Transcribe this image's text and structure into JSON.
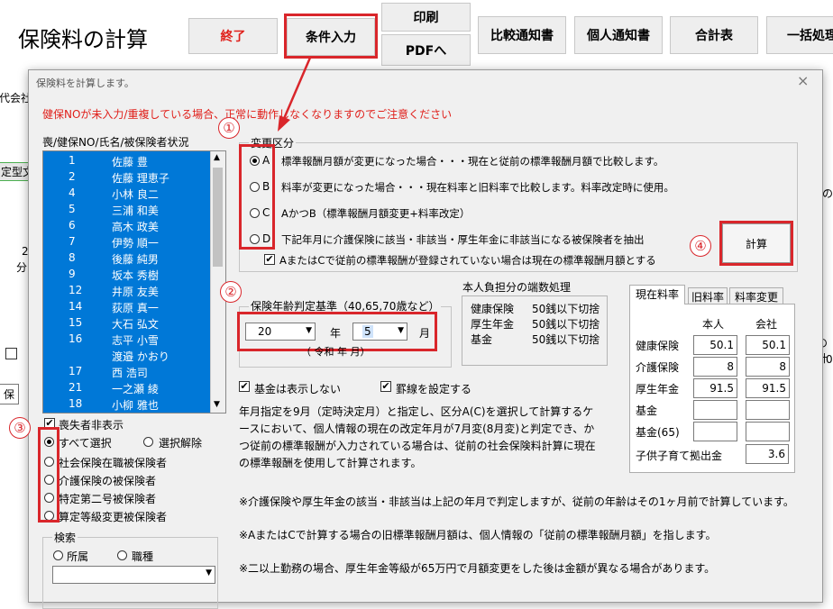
{
  "page_title": "保険料の計算",
  "toolbar": {
    "end": "終了",
    "condition_input": "条件入力",
    "print": "印刷",
    "to_pdf": "PDFへ",
    "compare_notice": "比較通知書",
    "personal_notice": "個人通知書",
    "total_table": "合計表",
    "batch": "一括処理"
  },
  "background": {
    "frag_company": "代会社",
    "frag_teiki": "定型文",
    "frag_bun": "分.",
    "frag_2": "2",
    "frag_ho": "保",
    "frag_no": "の",
    "frag_ke": "の計",
    "frag_0": "0"
  },
  "dialog": {
    "title": "保険料を計算します。",
    "close": "×",
    "warning": "健保NOが未入力/重複している場合、正常に動作しなくなりますのでご注意ください",
    "list_header": "喪/健保NO/氏名/被保険者状況",
    "employees": [
      {
        "no": "1",
        "name": "佐藤 豊"
      },
      {
        "no": "2",
        "name": "佐藤 理恵子"
      },
      {
        "no": "4",
        "name": "小林 良二"
      },
      {
        "no": "5",
        "name": "三浦 和美"
      },
      {
        "no": "6",
        "name": "高木 政美"
      },
      {
        "no": "7",
        "name": "伊勢 順一"
      },
      {
        "no": "8",
        "name": "後藤 純男"
      },
      {
        "no": "9",
        "name": "坂本 秀樹"
      },
      {
        "no": "12",
        "name": "井原 友美"
      },
      {
        "no": "14",
        "name": "荻原 真一"
      },
      {
        "no": "15",
        "name": "大石 弘文"
      },
      {
        "no": "16",
        "name": "志平 小雪"
      },
      {
        "no": "",
        "name": "渡邉 かおり"
      },
      {
        "no": "17",
        "name": "西 浩司"
      },
      {
        "no": "21",
        "name": "一之瀬 綾"
      },
      {
        "no": "18",
        "name": "小柳 雅也"
      }
    ],
    "hide_lost": "喪失者非表示",
    "select_all": "すべて選択",
    "deselect": "選択解除",
    "filters": [
      "社会保険在職被保険者",
      "介護保険の被保険者",
      "特定第二号被保険者",
      "算定等級変更被保険者"
    ],
    "search_legend": "検索",
    "search_dept": "所属",
    "search_job": "職種",
    "change_group": "変更区分",
    "change_options": [
      {
        "key": "A",
        "text": "標準報酬月額が変更になった場合・・・現在と従前の標準報酬月額で比較します。"
      },
      {
        "key": "B",
        "text": "料率が変更になった場合・・・現在料率と旧料率で比較します。料率改定時に使用。"
      },
      {
        "key": "C",
        "text": "AかつB（標準報酬月額変更+料率改定）"
      },
      {
        "key": "D",
        "text": "下記年月に介護保険に該当・非該当・厚生年金に非該当になる被保険者を抽出"
      }
    ],
    "ac_check": "AまたはCで従前の標準報酬が登録されていない場合は現在の標準報酬月額とする",
    "calc_button": "計算",
    "age_group": "保険年齢判定基準（40,65,70歳など）",
    "year_value": "20",
    "year_unit": "年",
    "month_value": "5",
    "month_unit": "月",
    "era_hint": "（ 令和  年  月）",
    "rounding_title": "本人負担分の端数処理",
    "rounding": [
      {
        "label": "健康保険",
        "value": "50銭以下切捨"
      },
      {
        "label": "厚生年金",
        "value": "50銭以下切捨"
      },
      {
        "label": "基金",
        "value": "50銭以下切捨"
      }
    ],
    "rate_tabs": [
      "現在料率",
      "旧料率",
      "料率変更"
    ],
    "rate_headers": {
      "person": "本人",
      "company": "会社"
    },
    "rates": [
      {
        "label": "健康保険",
        "person": "50.1",
        "company": "50.1"
      },
      {
        "label": "介護保険",
        "person": "8",
        "company": "8"
      },
      {
        "label": "厚生年金",
        "person": "91.5",
        "company": "91.5"
      },
      {
        "label": "基金",
        "person": "",
        "company": ""
      },
      {
        "label": "基金(65)",
        "person": "",
        "company": ""
      }
    ],
    "child_label": "子供子育て拠出金",
    "child_value": "3.6",
    "show_fund": "基金は表示しない",
    "ruled_lines": "罫線を設定する",
    "explanation": "年月指定を9月（定時決定月）と指定し、区分A(C)を選択して計算するケースにおいて、個人情報の現在の改定年月が7月変(8月変)と判定でき、かつ従前の標準報酬が入力されている場合は、従前の社会保険料計算に現在の標準報酬を使用して計算されます。",
    "note1": "※介護保険や厚生年金の該当・非該当は上記の年月で判定しますが、従前の年齢はその1ヶ月前で計算しています。",
    "note2": "※AまたはCで計算する場合の旧標準報酬月額は、個人情報の「従前の標準報酬月額」を指します。",
    "note3": "※二以上勤務の場合、厚生年金等級が65万円で月額変更をした後は金額が異なる場合があります。"
  },
  "annotations": [
    "①",
    "②",
    "③",
    "④"
  ],
  "colors": {
    "accent_red": "#d9262b",
    "list_blue": "#0078d7",
    "warning_red": "#e0201b"
  }
}
